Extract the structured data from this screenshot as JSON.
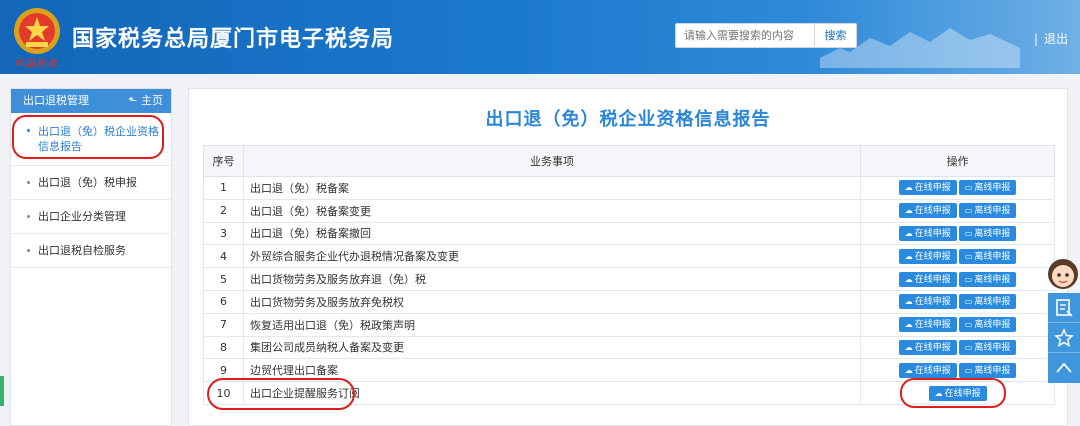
{
  "header": {
    "site_title": "国家税务总局厦门市电子税务局",
    "emblem_caption": "中国税务",
    "search_placeholder": "请输入需要搜索的内容",
    "search_button": "搜索",
    "logout": "退出",
    "separator": "|"
  },
  "sidebar": {
    "title": "出口退税管理",
    "home_label": "主页",
    "items": [
      {
        "label": "出口退（免）税企业资格信息报告",
        "active": true
      },
      {
        "label": "出口退（免）税申报",
        "active": false
      },
      {
        "label": "出口企业分类管理",
        "active": false
      },
      {
        "label": "出口退税自检服务",
        "active": false
      }
    ]
  },
  "main": {
    "title": "出口退（免）税企业资格信息报告",
    "columns": [
      "序号",
      "业务事项",
      "操作"
    ],
    "online_label": "在线申报",
    "offline_label": "离线申报",
    "rows": [
      {
        "seq": "1",
        "name": "出口退（免）税备案",
        "online": true,
        "offline": true
      },
      {
        "seq": "2",
        "name": "出口退（免）税备案变更",
        "online": true,
        "offline": true
      },
      {
        "seq": "3",
        "name": "出口退（免）税备案撤回",
        "online": true,
        "offline": true
      },
      {
        "seq": "4",
        "name": "外贸综合服务企业代办退税情况备案及变更",
        "online": true,
        "offline": true
      },
      {
        "seq": "5",
        "name": "出口货物劳务及服务放弃退（免）税",
        "online": true,
        "offline": true
      },
      {
        "seq": "6",
        "name": "出口货物劳务及服务放弃免税权",
        "online": true,
        "offline": true
      },
      {
        "seq": "7",
        "name": "恢复适用出口退（免）税政策声明",
        "online": true,
        "offline": true
      },
      {
        "seq": "8",
        "name": "集团公司成员纳税人备案及变更",
        "online": true,
        "offline": true
      },
      {
        "seq": "9",
        "name": "边贸代理出口备案",
        "online": true,
        "offline": true
      },
      {
        "seq": "10",
        "name": "出口企业提醒服务订阅",
        "online": true,
        "offline": false
      }
    ]
  },
  "colors": {
    "header_blue": "#1a78cc",
    "accent": "#2a86d8",
    "button": "#2a8ae0",
    "highlight_red": "#e21b1b"
  }
}
